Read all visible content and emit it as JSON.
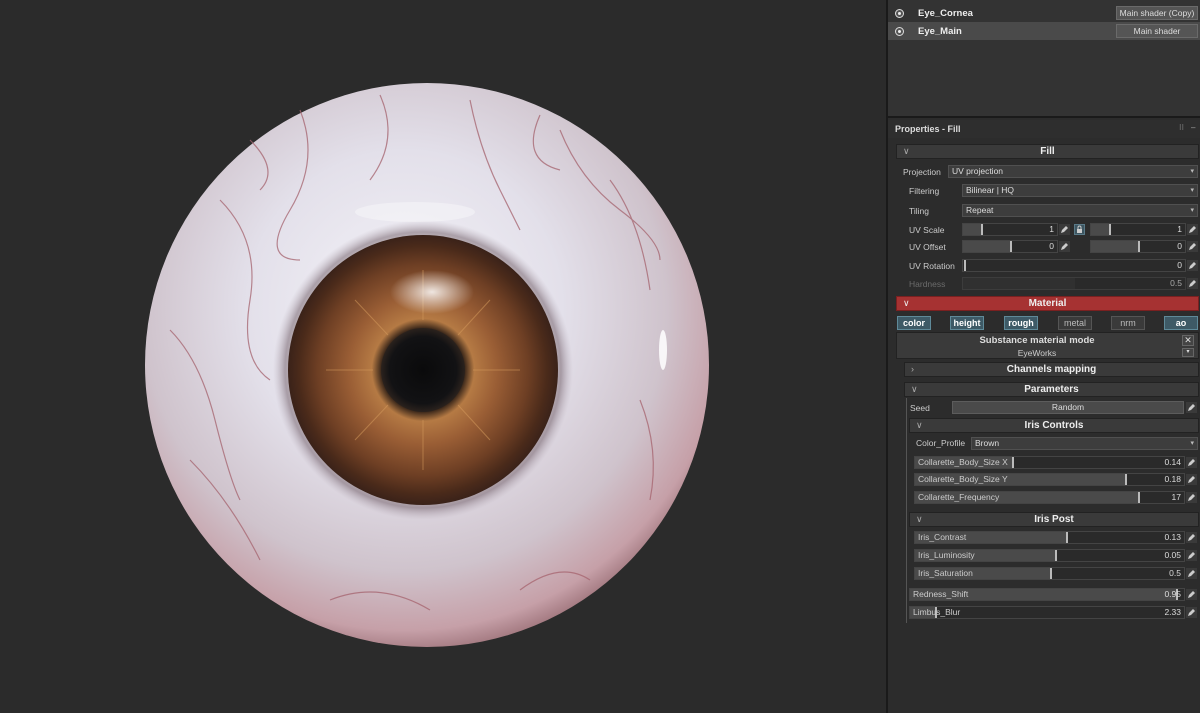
{
  "layers": [
    {
      "name": "Eye_Cornea",
      "shader": "Main shader (Copy)",
      "selected": false
    },
    {
      "name": "Eye_Main",
      "shader": "Main shader",
      "selected": true
    }
  ],
  "properties": {
    "title": "Properties - Fill",
    "fill": {
      "header": "Fill",
      "projection_label": "Projection",
      "projection_value": "UV projection",
      "filtering_label": "Filtering",
      "filtering_value": "Bilinear | HQ",
      "tiling_label": "Tiling",
      "tiling_value": "Repeat",
      "uv_scale_label": "UV Scale",
      "uv_scale_u": "1",
      "uv_scale_v": "1",
      "uv_offset_label": "UV Offset",
      "uv_offset_u": "0",
      "uv_offset_v": "0",
      "uv_rotation_label": "UV Rotation",
      "uv_rotation_value": "0",
      "hardness_label": "Hardness",
      "hardness_value": "0.5"
    },
    "material": {
      "header": "Material",
      "channels": [
        {
          "label": "color",
          "on": true
        },
        {
          "label": "height",
          "on": true
        },
        {
          "label": "rough",
          "on": true
        },
        {
          "label": "metal",
          "on": false
        },
        {
          "label": "nrm",
          "on": false
        },
        {
          "label": "ao",
          "on": true
        }
      ],
      "mode_title": "Substance material mode",
      "mode_value": "EyeWorks",
      "close_glyph": "✕",
      "more_glyph": "▾"
    },
    "channels_mapping": "Channels mapping",
    "parameters": {
      "header": "Parameters",
      "seed_label": "Seed",
      "seed_button": "Random"
    },
    "iris_controls": {
      "header": "Iris Controls",
      "color_profile_label": "Color_Profile",
      "color_profile_value": "Brown",
      "params": [
        {
          "name": "Collarette_Body_Size X",
          "value": "0.14",
          "level": 0.36
        },
        {
          "name": "Collarette_Body_Size Y",
          "value": "0.18",
          "level": 0.78
        },
        {
          "name": "Collarette_Frequency",
          "value": "17",
          "level": 0.83
        }
      ]
    },
    "iris_post": {
      "header": "Iris Post",
      "params": [
        {
          "name": "Iris_Contrast",
          "value": "0.13",
          "level": 0.56
        },
        {
          "name": "Iris_Luminosity",
          "value": "0.05",
          "level": 0.52
        },
        {
          "name": "Iris_Saturation",
          "value": "0.5",
          "level": 0.5
        }
      ]
    },
    "extra_params": [
      {
        "name": "Redness_Shift",
        "value": "0.95",
        "level": 0.97
      },
      {
        "name": "Limbus_Blur",
        "value": "2.33",
        "level": 0.09
      }
    ]
  },
  "colors": {
    "material_header": "#a63232",
    "channel_on": "#3e5a66",
    "iris": "#7a4a2c",
    "sclera": "#e6e2ea"
  }
}
